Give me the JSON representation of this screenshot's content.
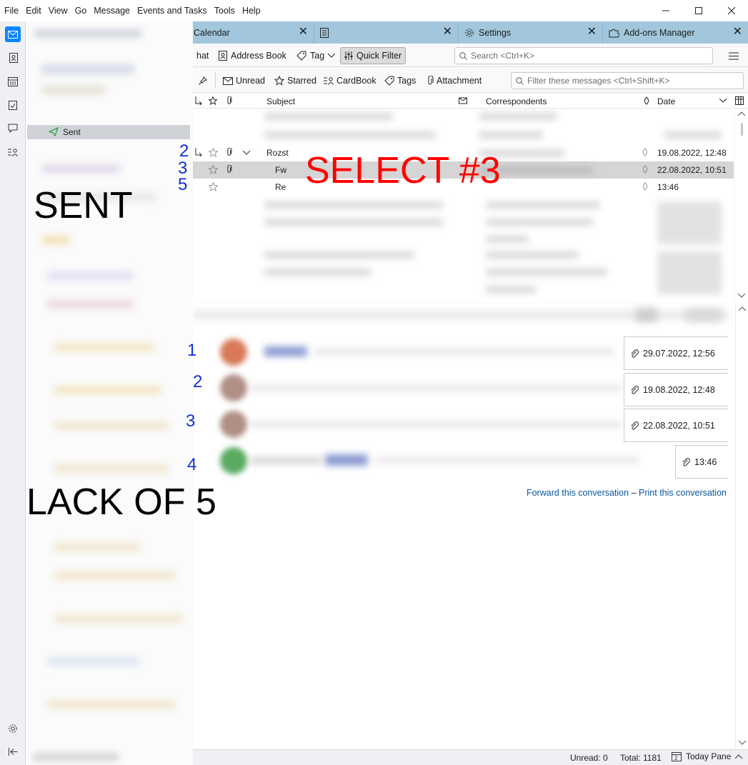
{
  "menu": [
    "File",
    "Edit",
    "View",
    "Go",
    "Message",
    "Events and Tasks",
    "Tools",
    "Help"
  ],
  "window_controls": [
    "minimize",
    "maximize",
    "close"
  ],
  "folder_pane": {
    "selected_folder": "Sent"
  },
  "tabs": [
    {
      "label": "Calendar",
      "icon": "calendar-icon"
    },
    {
      "label": "",
      "icon": "document-icon"
    },
    {
      "label": "Settings",
      "icon": "gear-icon"
    },
    {
      "label": "Add-ons Manager",
      "icon": "puzzle-icon"
    }
  ],
  "toolbar": {
    "chat_label": "hat",
    "address_book_label": "Address Book",
    "tag_label": "Tag",
    "quick_filter_label": "Quick Filter",
    "search_placeholder": "Search <Ctrl+K>"
  },
  "quick_filter": {
    "unread": "Unread",
    "starred": "Starred",
    "cardbook": "CardBook",
    "tags": "Tags",
    "attachment": "Attachment",
    "filter_placeholder": "Filter these messages <Ctrl+Shift+K>"
  },
  "thread_columns": {
    "subject": "Subject",
    "correspondents": "Correspondents",
    "date": "Date"
  },
  "thread_rows": [
    {
      "subject": "Rozst",
      "date": "19.08.2022, 12:48"
    },
    {
      "subject": "Fw",
      "date": "22.08.2022, 10:51",
      "selected": true
    },
    {
      "subject": "Re",
      "date": "13:46"
    }
  ],
  "conversation_messages": [
    {
      "date": "29.07.2022, 12:56",
      "avatar_color": "#d87a5a"
    },
    {
      "date": "19.08.2022, 12:48",
      "avatar_color": "#b08f84"
    },
    {
      "date": "22.08.2022, 10:51",
      "avatar_color": "#b08f84"
    },
    {
      "date": "13:46",
      "avatar_color": "#5aaa62"
    }
  ],
  "conversation_links": {
    "forward": "Forward this conversation",
    "separator": "–",
    "print": "Print this conversation"
  },
  "status_bar": {
    "unread": "Unread: 0",
    "total": "Total: 1181",
    "today_pane": "Today Pane"
  },
  "annotations": {
    "sent": "SENT",
    "lack": "LACK OF 5",
    "select": "SELECT #3",
    "thread_numbers": [
      "2",
      "3",
      "5"
    ],
    "conversation_numbers": [
      "1",
      "2",
      "3",
      "4"
    ]
  },
  "colors": {
    "accent": "#0a84ff",
    "tabbar": "#a2c7dc",
    "link": "#0a57a3",
    "annotation_red": "#ff0000",
    "annotation_blue": "#1030d8"
  }
}
